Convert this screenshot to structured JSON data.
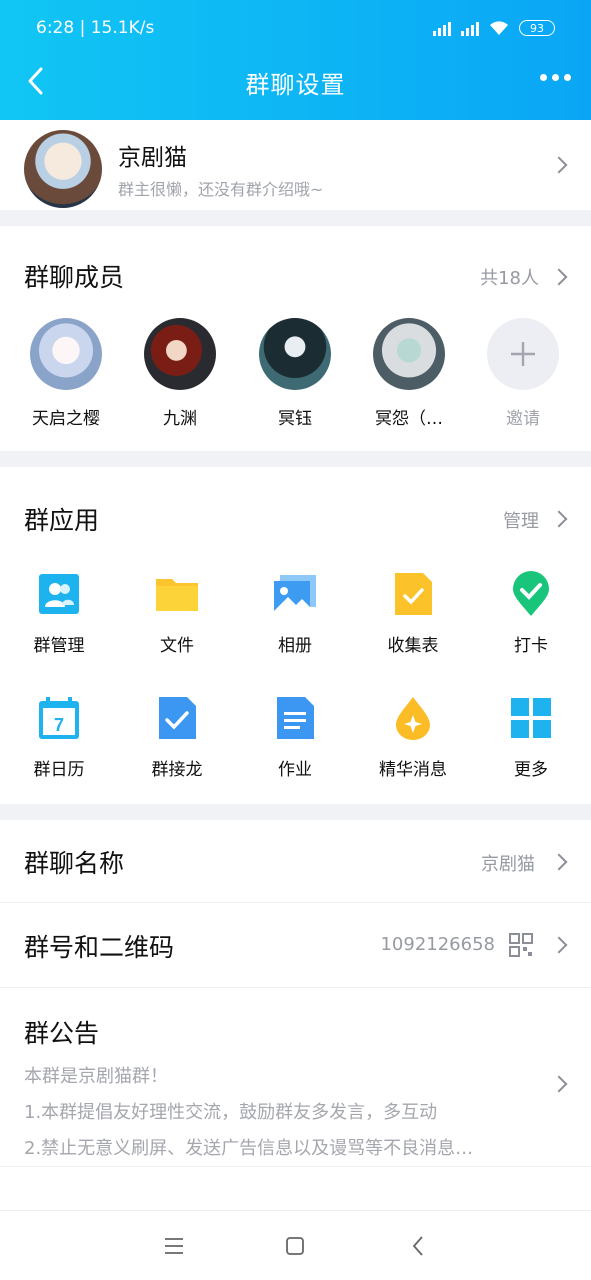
{
  "status": {
    "time": "6:28",
    "speed": "15.1K/s",
    "battery": "93"
  },
  "titlebar": {
    "title": "群聊设置"
  },
  "group": {
    "name": "京剧猫",
    "desc": "群主很懒，还没有群介绍哦~"
  },
  "members": {
    "title": "群聊成员",
    "count": "共18人",
    "list": [
      {
        "name": "天启之樱"
      },
      {
        "name": "九渊"
      },
      {
        "name": "冥钰"
      },
      {
        "name": "冥怨（…"
      }
    ],
    "invite": "邀请"
  },
  "apps": {
    "title": "群应用",
    "manage": "管理",
    "items": [
      {
        "label": "群管理",
        "icon": "group-manage-icon"
      },
      {
        "label": "文件",
        "icon": "folder-icon"
      },
      {
        "label": "相册",
        "icon": "album-icon"
      },
      {
        "label": "收集表",
        "icon": "form-icon"
      },
      {
        "label": "打卡",
        "icon": "checkin-icon"
      },
      {
        "label": "群日历",
        "icon": "calendar-icon"
      },
      {
        "label": "群接龙",
        "icon": "relay-icon"
      },
      {
        "label": "作业",
        "icon": "homework-icon"
      },
      {
        "label": "精华消息",
        "icon": "essence-icon"
      },
      {
        "label": "更多",
        "icon": "more-apps-icon"
      }
    ]
  },
  "settings": {
    "name_label": "群聊名称",
    "name_value": "京剧猫",
    "id_label": "群号和二维码",
    "id_value": "1092126658",
    "notice_label": "群公告",
    "notice_lines": [
      "本群是京剧猫群！",
      "1.本群提倡友好理性交流，鼓励群友多发言，多互动",
      "2.禁止无意义刷屏、发送广告信息以及谩骂等不良消息…"
    ]
  },
  "colors": {
    "header_start": "#11c6f4",
    "header_end": "#0aa6f5",
    "accent": "#1fa3f5"
  }
}
